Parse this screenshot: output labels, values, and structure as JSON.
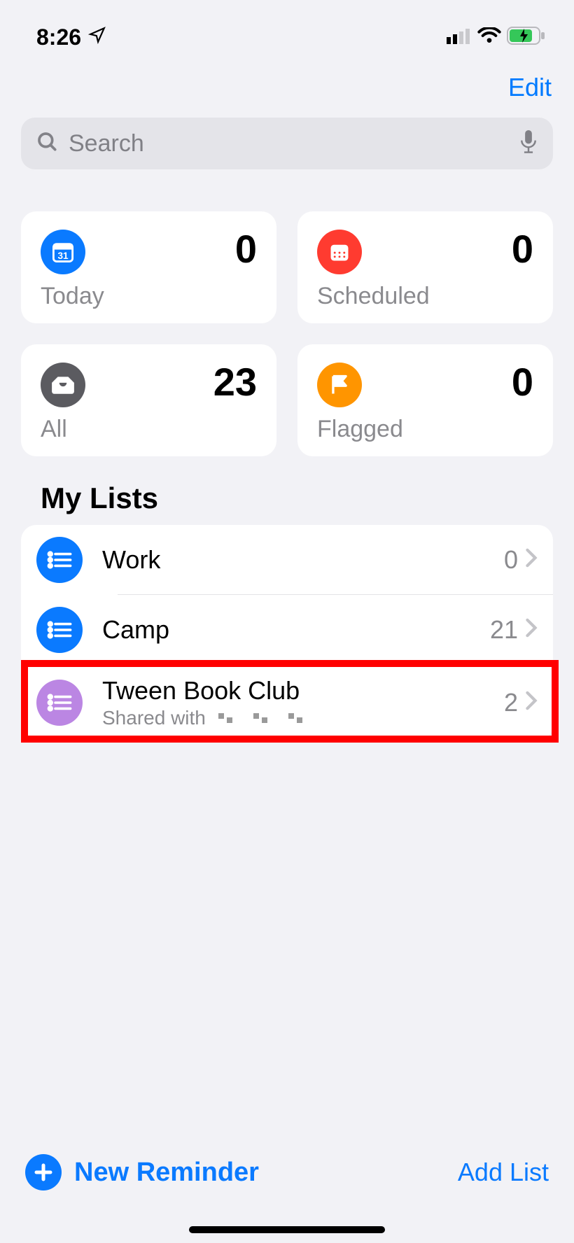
{
  "status": {
    "time": "8:26"
  },
  "header": {
    "edit": "Edit"
  },
  "search": {
    "placeholder": "Search"
  },
  "cards": {
    "today": {
      "label": "Today",
      "count": "0"
    },
    "scheduled": {
      "label": "Scheduled",
      "count": "0"
    },
    "all": {
      "label": "All",
      "count": "23"
    },
    "flagged": {
      "label": "Flagged",
      "count": "0"
    }
  },
  "sectionTitle": "My Lists",
  "lists": {
    "work": {
      "name": "Work",
      "count": "0"
    },
    "camp": {
      "name": "Camp",
      "count": "21"
    },
    "tween": {
      "name": "Tween Book Club",
      "sub": "Shared with",
      "count": "2"
    }
  },
  "bottom": {
    "newReminder": "New Reminder",
    "addList": "Add List"
  }
}
